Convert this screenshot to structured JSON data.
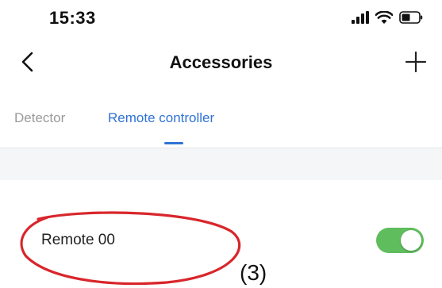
{
  "status_bar": {
    "time": "15:33",
    "icons": [
      "signal-icon",
      "wifi-icon",
      "battery-icon"
    ]
  },
  "nav": {
    "title": "Accessories",
    "back_icon": "chevron-left-icon",
    "add_icon": "plus-icon"
  },
  "tabs": [
    {
      "label": "Detector",
      "active": false
    },
    {
      "label": "Remote controller",
      "active": true
    }
  ],
  "remotes": [
    {
      "name": "Remote 00",
      "enabled": true
    }
  ],
  "annotation": {
    "label": "(3)",
    "color": "#d8262b"
  },
  "colors": {
    "accent": "#2f73d6",
    "toggle_on": "#5fbd5d",
    "inactive_tab": "#9a9a9a"
  }
}
